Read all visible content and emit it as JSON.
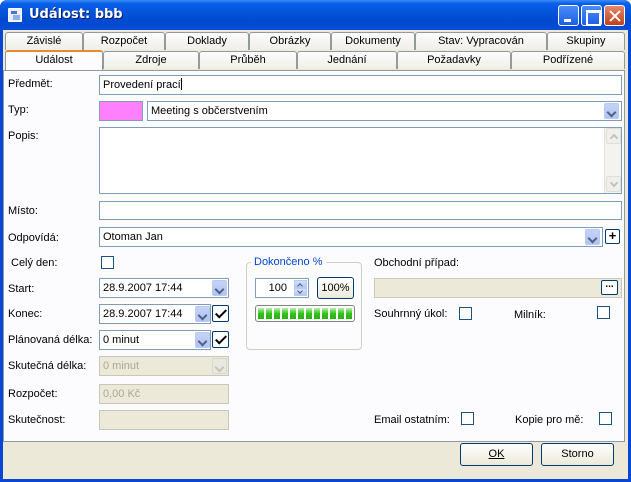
{
  "window": {
    "title": "Událost: bbb"
  },
  "tabs_top": [
    "Závislé",
    "Rozpočet",
    "Doklady",
    "Obrázky",
    "Dokumenty",
    "Stav: Vypracován",
    "Skupiny"
  ],
  "tabs_bottom": [
    "Událost",
    "Zdroje",
    "Průběh",
    "Jednání",
    "Požadavky",
    "Podřízené"
  ],
  "form": {
    "predmet_label": "Předmět:",
    "predmet_value": "Provedení prací",
    "typ_label": "Typ:",
    "typ_value": "Meeting s občerstvením",
    "typ_color": "#ff80ff",
    "popis_label": "Popis:",
    "popis_value": "",
    "misto_label": "Místo:",
    "misto_value": "",
    "odpovida_label": "Odpovídá:",
    "odpovida_value": "Otoman Jan",
    "cely_den_label": "Celý den:",
    "start_label": "Start:",
    "start_value": "28.9.2007 17:44",
    "konec_label": "Konec:",
    "konec_value": "28.9.2007 17:44",
    "planovana_label": "Plánovaná délka:",
    "planovana_value": "0 minut",
    "skutecna_label": "Skutečná délka:",
    "skutecna_value": "0 minut",
    "rozpocet_label": "Rozpočet:",
    "rozpocet_value": "0,00 Kč",
    "skutecnost_label": "Skutečnost:",
    "skutecnost_value": ""
  },
  "dokonceno": {
    "title": "Dokončeno %",
    "value": "100",
    "button_label": "100%",
    "progress_fraction": 1.0
  },
  "right": {
    "obchodni_pripad_label": "Obchodní případ:",
    "obchodni_pripad_value": "",
    "ellipsis_label": "...",
    "souhrnny_ukol_label": "Souhrnný úkol:",
    "milnik_label": "Milník:",
    "email_ostatnim_label": "Email ostatním:",
    "kopie_pro_me_label": "Kopie pro mě:"
  },
  "buttons": {
    "ok": "OK",
    "storno": "Storno"
  }
}
